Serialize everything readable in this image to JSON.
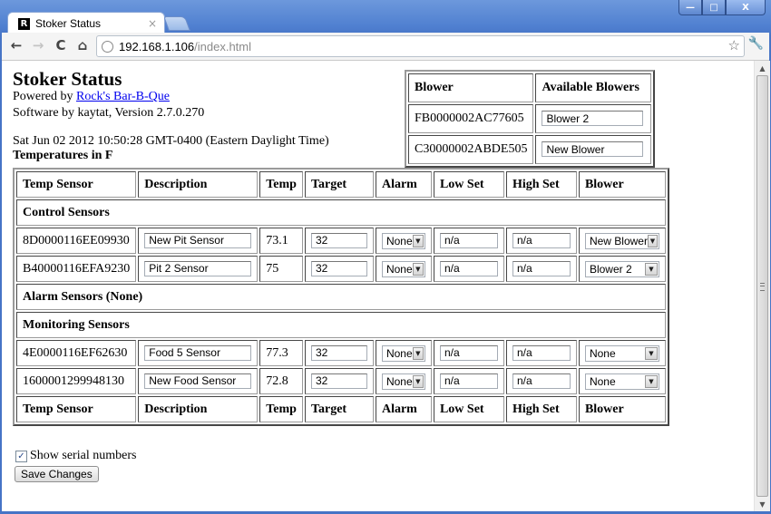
{
  "browser": {
    "tab_title": "Stoker Status",
    "favicon_letter": "R",
    "tab_close_glyph": "×",
    "url_host": "192.168.1.106",
    "url_path": "/index.html",
    "back_glyph": "←",
    "forward_glyph": "→",
    "reload_glyph": "C",
    "home_glyph": "⌂",
    "star_glyph": "☆",
    "wrench_glyph": "🔧",
    "win_min": "—",
    "win_max": "□",
    "win_close": "X"
  },
  "page": {
    "title": "Stoker Status",
    "powered_by_prefix": "Powered by ",
    "powered_by_link": "Rock's Bar-B-Que",
    "software_line": "Software by kaytat, Version 2.7.0.270",
    "timestamp": "Sat Jun 02 2012 10:50:28 GMT-0400 (Eastern Daylight Time)",
    "units_label": "Temperatures in F"
  },
  "blowers_table": {
    "headers": [
      "Blower",
      "Available Blowers"
    ],
    "rows": [
      {
        "serial": "FB0000002AC77605",
        "name": "Blower 2"
      },
      {
        "serial": "C30000002ABDE505",
        "name": "New Blower"
      }
    ]
  },
  "sensors_table": {
    "headers": [
      "Temp Sensor",
      "Description",
      "Temp",
      "Target",
      "Alarm",
      "Low Set",
      "High Set",
      "Blower"
    ],
    "sections": {
      "control": "Control Sensors",
      "alarm": "Alarm Sensors (None)",
      "monitoring": "Monitoring Sensors"
    },
    "control_rows": [
      {
        "serial": "8D0000116EE09930",
        "description": "New Pit Sensor",
        "temp": "73.1",
        "target": "32",
        "alarm": "None",
        "low": "n/a",
        "high": "n/a",
        "blower": "New Blower"
      },
      {
        "serial": "B40000116EFA9230",
        "description": "Pit 2 Sensor",
        "temp": "75",
        "target": "32",
        "alarm": "None",
        "low": "n/a",
        "high": "n/a",
        "blower": "Blower 2"
      }
    ],
    "monitoring_rows": [
      {
        "serial": "4E0000116EF62630",
        "description": "Food 5 Sensor",
        "temp": "77.3",
        "target": "32",
        "alarm": "None",
        "low": "n/a",
        "high": "n/a",
        "blower": "None"
      },
      {
        "serial": "1600001299948130",
        "description": "New Food Sensor",
        "temp": "72.8",
        "target": "32",
        "alarm": "None",
        "low": "n/a",
        "high": "n/a",
        "blower": "None"
      }
    ]
  },
  "footer": {
    "show_serials_label": "Show serial numbers",
    "show_serials_checked": true,
    "check_glyph": "✓",
    "save_label": "Save Changes"
  },
  "select_arrow_glyph": "▼",
  "scroll_up_glyph": "▲",
  "scroll_down_glyph": "▼"
}
